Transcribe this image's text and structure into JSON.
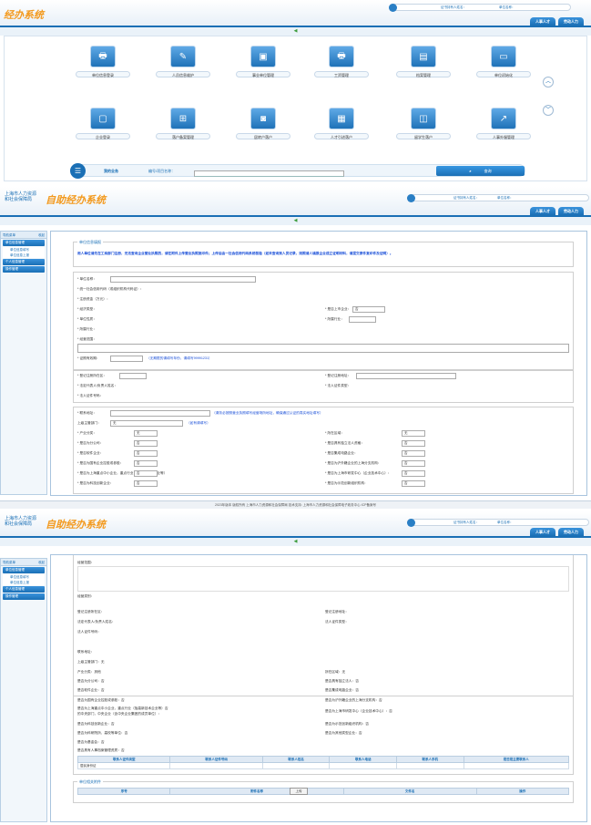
{
  "app_title": "经办系统",
  "logo_line1": "上海市人力资源",
  "logo_line2": "和社会保障局",
  "logo_main": "自助经办系统",
  "user": {
    "label1": "证书持有人姓名：",
    "label2": "单位名称："
  },
  "nav": {
    "tab1": "人事人才",
    "tab2": "劳动人力"
  },
  "tiles": [
    {
      "label": "单位信息登录",
      "icon": "printer-icon"
    },
    {
      "label": "人员信息维护",
      "icon": "edit-icon"
    },
    {
      "label": "事业单位管理",
      "icon": "monitor-chat-icon"
    },
    {
      "label": "工资管理",
      "icon": "printer-icon"
    },
    {
      "label": "档案管理",
      "icon": "id-card-icon"
    },
    {
      "label": "单位初始化",
      "icon": "screen-icon"
    },
    {
      "label": "企业登录",
      "icon": "monitor-icon"
    },
    {
      "label": "落户备案管理",
      "icon": "org-chart-icon"
    },
    {
      "label": "居转户落户",
      "icon": "safe-icon"
    },
    {
      "label": "人才引进落户",
      "icon": "calendar-icon"
    },
    {
      "label": "留学生落户",
      "icon": "computer-icon"
    },
    {
      "label": "人事外服管理",
      "icon": "chart-icon"
    }
  ],
  "search": {
    "title": "我的业务",
    "label": "编号/项目名称：",
    "button": "查询"
  },
  "sidebar": {
    "head": "导航菜单",
    "head_right": "收起",
    "items": [
      "单位信息管理",
      "个人信息管理",
      "操作管理"
    ],
    "subs": [
      "单位信息填写",
      "单位信息上报"
    ]
  },
  "form": {
    "legend1": "单位信息填报",
    "notice": "用人单位请先在工商部门注册，无法查询企业营业执照的，请在附件上传营业执照复印件；上传后由一社会信用代码系统核验（如未查询到人员记录，则照请人填报企业成立证明材料，请提交原件复印件及证明）。",
    "labels": {
      "name": "* 单位名称：",
      "credit": "* 统一社会信用代码（或组织机构代码证）：",
      "capital": "* 注册资金（万元）：",
      "econ": "* 经济类型：",
      "listed": "* 是否上市企业：",
      "regaddr": "* 单位性质：",
      "scale": "* 所属行业：",
      "biz": "* 经营范围：",
      "industry": "* 所属行业：",
      "reg_district": "* 登记注册所在区：",
      "reg_address": "* 登记注册地址：",
      "legal": "* 法定代表人/负责人姓名：",
      "legal_cert": "* 法人证件号码：",
      "law_cert_type": "* 法人证件类型："
    },
    "expire_label": "* 证照有效期：",
    "expire_note": "（无期限的请填写年份，请填写99991231）",
    "address_label": "* 联系地址：",
    "address_note": "（请务必按照营业执照填写经营场所地址，确保通过认证的真实地址填写）",
    "dept_label": "上级主管部门：",
    "dept_value": "无",
    "dept_note": "（如有请填写）",
    "sel_no": "否",
    "sel_none": "无",
    "pairs": [
      [
        "* 产业分类：",
        "* 所在区域："
      ],
      [
        "* 是否为分公司：",
        "* 是否具有独立法人资格："
      ],
      [
        "* 是否软件企业：",
        "* 是否集成电路企业："
      ],
      [
        "* 是否为国有企业控股或参股：",
        "* 是否为沪外籍企业的上海分支机构："
      ],
      [
        "* 是否为上海重点中小企业，重点行业（指高新技术企业等）",
        "* 是否为上海市研发中心（企业技术中心）："
      ],
      [
        "* 是否为科技创新企业：",
        "* 是否为示范创新组织机构："
      ]
    ],
    "footer": "2023年版本 版权所有 上海市人力资源和社会保障局 技术支持: 上海市人力资源和社会保障电子政务中心 ICP备案号",
    "ro_labels": {
      "biz": "经营范围：",
      "biz2": "经营类别：",
      "reg_district": "登记注册所在区：",
      "reg_address": "登记注册地址：",
      "legal": "法定代表人/负责人姓名：",
      "legal_cert": "法人证件类型：",
      "legal_no": "法人证件号码：",
      "contact": "联系地址：",
      "dept": "上级主管部门：",
      "dept_v": "无",
      "industry": "产业分类：",
      "industry_v": "其他",
      "area": "所在区域：",
      "area_v": "无",
      "branch": "是否为分公司：",
      "branch_v": "否",
      "legal_ind": "是否具有独立法人：",
      "legal_ind_v": "否",
      "software": "是否软件企业：",
      "software_v": "否",
      "ic": "是否集成电路企业：",
      "ic_v": "否",
      "state": "是否为国有企业控股或参股：",
      "state_v": "否",
      "hw": "是否为沪外籍企业的上海分支机构：",
      "hw_v": "否",
      "key": "是否为上海重点中小企业，重点行业（指高新技术企业等）",
      "key2": "的中央部门，中央企业（含中央企业集团的成员单位）：",
      "key_v": "否",
      "rd": "是否为上海市研发中心（企业技术中心）：",
      "rd_v": "否",
      "tech": "是否为科技创新企业：",
      "tech_v": "否",
      "demo": "是否为示范创新组织机构：",
      "demo_v": "否",
      "science": "是否为科研院所、高校等单位：",
      "science_v": "否",
      "other": "是否为其他类型企业：",
      "other_v": "否",
      "fund": "是否为基金会：",
      "fund_v": "否",
      "high": "是否具有人事档案管理资质：",
      "high_v": "否"
    },
    "contacts_headers": [
      "联系人证件类型",
      "联系人证件号码",
      "联系人姓名",
      "联系人电话",
      "联系人手机",
      "是否是主要联系人"
    ],
    "contacts_row": [
      "居民身份证",
      "",
      "",
      "",
      "",
      ""
    ],
    "attach_legend": "单位相关附件",
    "attach_headers": [
      "序号",
      "附件名称",
      "文件名",
      "操作"
    ],
    "upload_label": "上传"
  }
}
